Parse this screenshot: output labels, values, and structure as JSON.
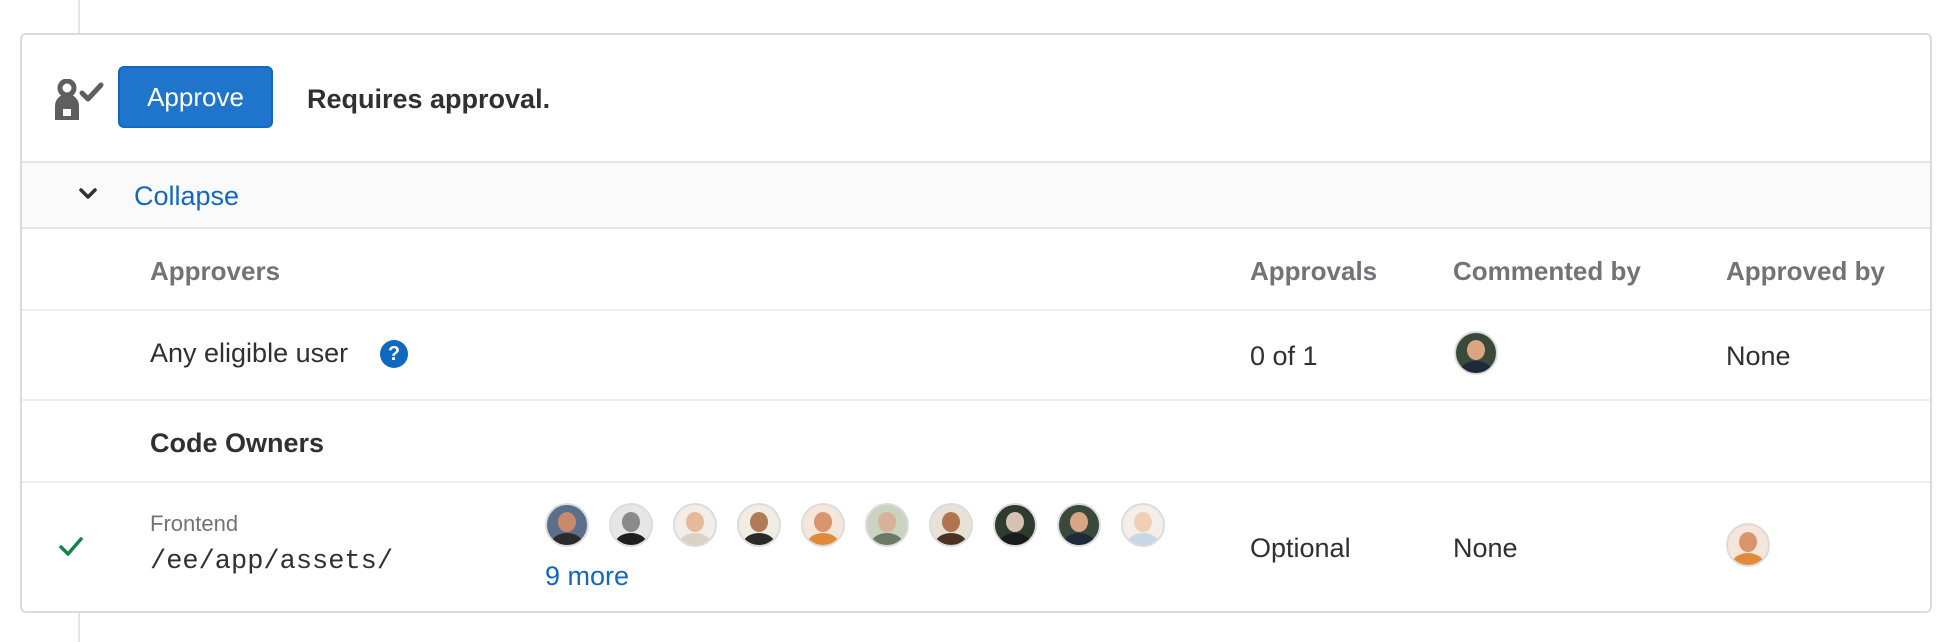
{
  "header": {
    "approve_label": "Approve",
    "requires_text": "Requires approval.",
    "icon": "approval-user-check-icon"
  },
  "collapse": {
    "label": "Collapse",
    "icon": "chevron-down-icon"
  },
  "table": {
    "headers": {
      "approvers": "Approvers",
      "approvals": "Approvals",
      "commented_by": "Commented by",
      "approved_by": "Approved by"
    },
    "rows": {
      "any_eligible": {
        "approvers": "Any eligible user",
        "help_icon": "question-circle-icon",
        "help_glyph": "?",
        "approvals": "0 of 1",
        "commented_by_avatar": "user-avatar",
        "approved_by": "None"
      },
      "code_owners_section": {
        "title": "Code Owners"
      },
      "frontend": {
        "status_icon": "check-icon",
        "group_name": "Frontend",
        "path": "/ee/app/assets/",
        "approver_avatar_count": 10,
        "more_label": "9 more",
        "approvals": "Optional",
        "commented_by": "None",
        "approved_by_avatar": "user-avatar"
      }
    }
  },
  "colors": {
    "primary": "#1f75cb",
    "link": "#1068bf",
    "success": "#108548",
    "border": "#dbdbdb",
    "muted_text": "#737278",
    "text": "#303030"
  }
}
